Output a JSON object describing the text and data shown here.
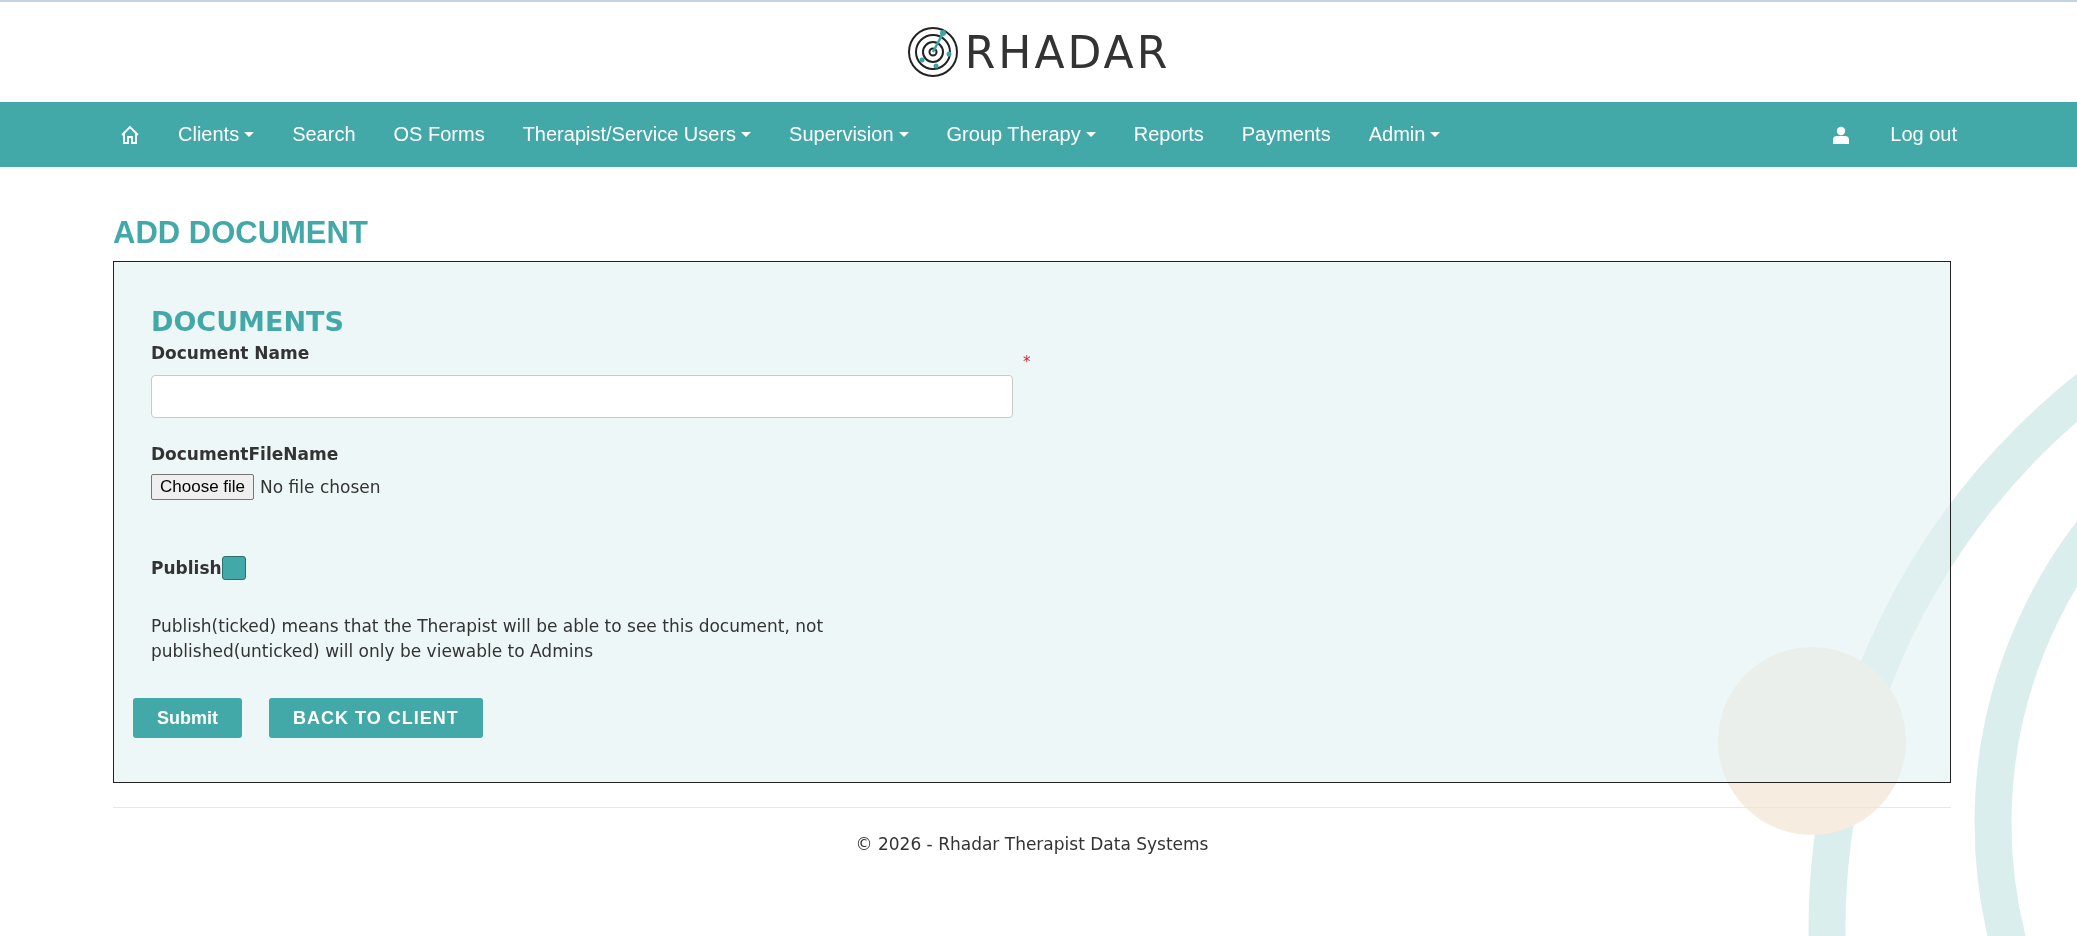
{
  "header": {
    "logo_text": "RHADAR"
  },
  "nav": {
    "items": [
      {
        "label": "Clients",
        "dropdown": true
      },
      {
        "label": "Search",
        "dropdown": false
      },
      {
        "label": "OS Forms",
        "dropdown": false
      },
      {
        "label": "Therapist/Service Users",
        "dropdown": true
      },
      {
        "label": "Supervision",
        "dropdown": true
      },
      {
        "label": "Group Therapy",
        "dropdown": true
      },
      {
        "label": "Reports",
        "dropdown": false
      },
      {
        "label": "Payments",
        "dropdown": false
      },
      {
        "label": "Admin",
        "dropdown": true
      }
    ],
    "logout": "Log out"
  },
  "page_title": "ADD DOCUMENT",
  "form": {
    "heading": "DOCUMENTS",
    "document_name": {
      "label": "Document Name",
      "required": true,
      "required_mark": "*"
    },
    "file": {
      "label": "DocumentFileName",
      "button": "Choose file",
      "status": "No file chosen"
    },
    "publish": {
      "label": "Publish",
      "checked": false
    },
    "note": "Publish(ticked) means that the Therapist will be able to see this document, not published(unticked) will only be viewable to Admins",
    "buttons": [
      {
        "label": "Submit",
        "kind": "submit"
      },
      {
        "label": "BACK TO CLIENT",
        "kind": "back"
      }
    ]
  },
  "footer": "© 2026 - Rhadar Therapist Data Systems"
}
